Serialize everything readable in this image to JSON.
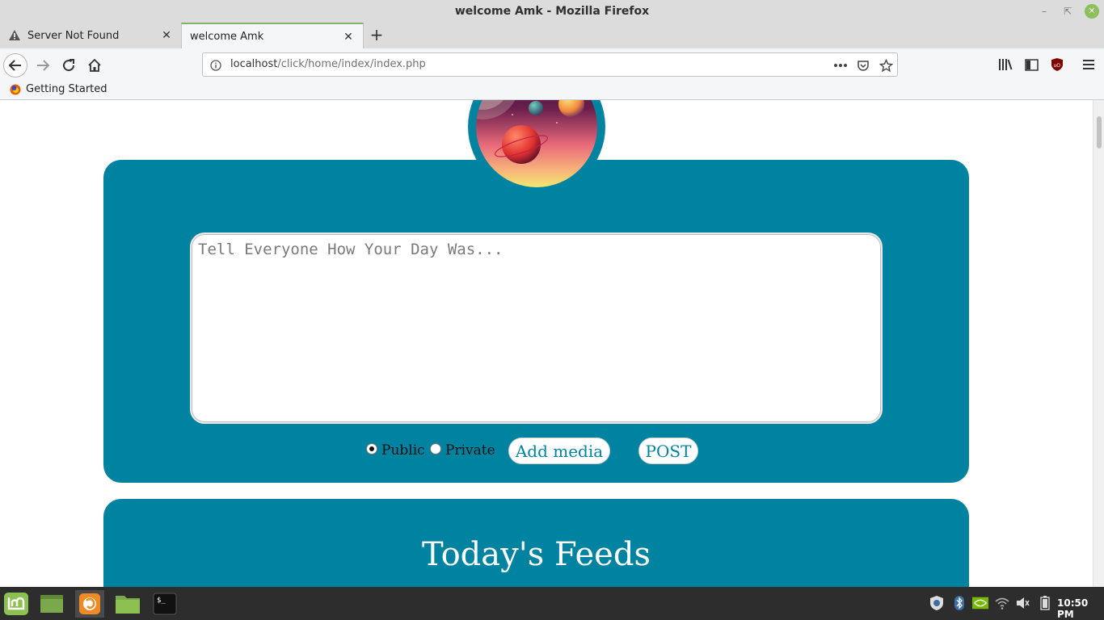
{
  "window": {
    "title": "welcome Amk - Mozilla Firefox"
  },
  "tabs": [
    {
      "label": "Server Not Found",
      "active": false
    },
    {
      "label": "welcome Amk",
      "active": true
    }
  ],
  "navbar": {
    "url_host": "localhost",
    "url_path": "/click/home/index/index.php"
  },
  "bookmarks": [
    {
      "label": "Getting Started"
    }
  ],
  "composer": {
    "placeholder": "Tell Everyone How Your Day Was...",
    "visibility_options": [
      {
        "label": "Public",
        "selected": true
      },
      {
        "label": "Private",
        "selected": false
      }
    ],
    "add_media_label": "Add media",
    "post_label": "POST"
  },
  "feeds": {
    "title": "Today's Feeds"
  },
  "taskbar": {
    "clock": "10:50 PM"
  },
  "colors": {
    "accent": "#0083a0",
    "titlebar": "#dcdcdc",
    "taskbar": "#2d2d2d"
  }
}
